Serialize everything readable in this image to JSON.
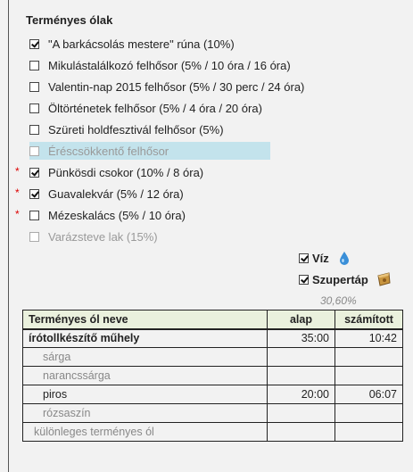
{
  "heading": "Terményes ólak",
  "options": [
    {
      "label": "\"A barkácsolás mestere\" rúna (10%)",
      "checked": true,
      "dim": false,
      "highlight": false,
      "required": false
    },
    {
      "label": "Mikulástalálkozó felhősor (5% / 10 óra / 16 óra)",
      "checked": false,
      "dim": false,
      "highlight": false,
      "required": false
    },
    {
      "label": "Valentin-nap 2015 felhősor (5% / 30 perc / 24 óra)",
      "checked": false,
      "dim": false,
      "highlight": false,
      "required": false
    },
    {
      "label": "Öltörténetek felhősor (5% / 4 óra / 20 óra)",
      "checked": false,
      "dim": false,
      "highlight": false,
      "required": false
    },
    {
      "label": "Szüreti holdfesztivál felhősor (5%)",
      "checked": false,
      "dim": false,
      "highlight": false,
      "required": false
    },
    {
      "label": "Éréscsökkentő felhősor",
      "checked": false,
      "dim": true,
      "highlight": true,
      "required": false
    },
    {
      "label": "Pünkösdi csokor (10% / 8 óra)",
      "checked": true,
      "dim": false,
      "highlight": false,
      "required": true
    },
    {
      "label": "Guavalekvár (5% / 12 óra)",
      "checked": true,
      "dim": false,
      "highlight": false,
      "required": true
    },
    {
      "label": "Mézeskalács (5% / 10 óra)",
      "checked": false,
      "dim": false,
      "highlight": false,
      "required": true
    },
    {
      "label": "Varázsteve lak (15%)",
      "checked": false,
      "dim": true,
      "highlight": false,
      "required": false
    }
  ],
  "required_mark": "*",
  "resources": {
    "water": {
      "label": "Víz",
      "checked": true,
      "icon": "water-drop-icon"
    },
    "fertilizer": {
      "label": "Szupertáp",
      "checked": true,
      "icon": "fertilizer-bag-icon"
    }
  },
  "percent": "30,60%",
  "table": {
    "headers": [
      "Terményes ól neve",
      "alap",
      "számított"
    ],
    "rows": [
      {
        "name": "írótollkészítő műhely",
        "base": "35:00",
        "calc": "10:42",
        "kind": "main"
      },
      {
        "name": "sárga",
        "base": "",
        "calc": "",
        "kind": "grey"
      },
      {
        "name": "narancssárga",
        "base": "",
        "calc": "",
        "kind": "grey"
      },
      {
        "name": "piros",
        "base": "20:00",
        "calc": "06:07",
        "kind": "sub"
      },
      {
        "name": "rózsaszín",
        "base": "",
        "calc": "",
        "kind": "grey"
      },
      {
        "name": "különleges terményes ól",
        "base": "",
        "calc": "",
        "kind": "last"
      }
    ]
  }
}
